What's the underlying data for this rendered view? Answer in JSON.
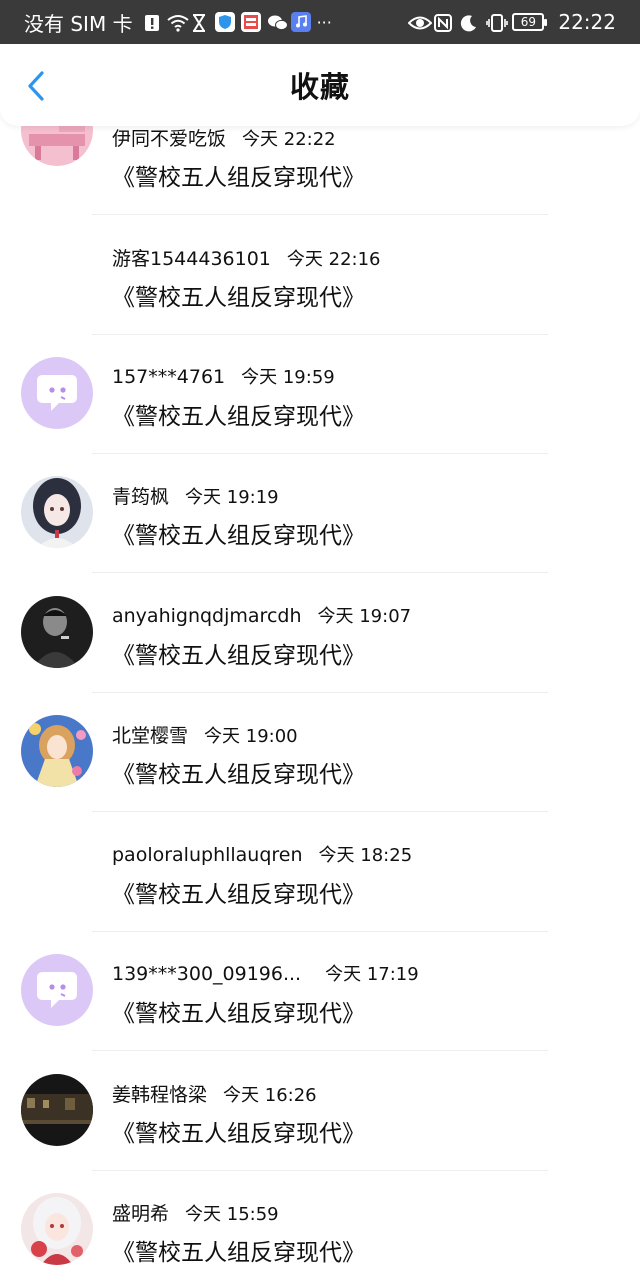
{
  "status_bar": {
    "carrier": "没有 SIM 卡",
    "battery": "69",
    "time": "22:22",
    "more": "···"
  },
  "header": {
    "title": "收藏",
    "back_icon": "chevron-left-icon"
  },
  "colors": {
    "accent": "#2f95ec",
    "status_bar_bg": "#3a3a3a",
    "divider": "#eeeeee",
    "chat_avatar_bg": "#dcc8f6",
    "chat_avatar_icon": "#b58ee8"
  },
  "items": [
    {
      "user": "伊同不爱吃饭",
      "time": "今天 22:22",
      "book": "《警校五人组反穿现代》",
      "avatar": "pink-room-illustration"
    },
    {
      "user": "游客1544436101",
      "time": "今天 22:16",
      "book": "《警校五人组反穿现代》",
      "avatar": "none"
    },
    {
      "user": "157***4761",
      "time": "今天 19:59",
      "book": "《警校五人组反穿现代》",
      "avatar": "default-chat-icon"
    },
    {
      "user": "青筠枫",
      "time": "今天 19:19",
      "book": "《警校五人组反穿现代》",
      "avatar": "anime-girl-portrait"
    },
    {
      "user": "anyahignqdjmarcdh",
      "time": "今天 19:07",
      "book": "《警校五人组反穿现代》",
      "avatar": "black-white-man-photo"
    },
    {
      "user": "北堂樱雪",
      "time": "今天 19:00",
      "book": "《警校五人组反穿现代》",
      "avatar": "anime-girl-gold-dress"
    },
    {
      "user": "paoloraluphllauqren",
      "time": "今天 18:25",
      "book": "《警校五人组反穿现代》",
      "avatar": "none"
    },
    {
      "user": "139***300_09196...",
      "time": "今天 17:19",
      "book": "《警校五人组反穿现代》",
      "avatar": "default-chat-icon"
    },
    {
      "user": "姜韩程恪梁",
      "time": "今天 16:26",
      "book": "《警校五人组反穿现代》",
      "avatar": "dark-street-scene"
    },
    {
      "user": "盛明希",
      "time": "今天 15:59",
      "book": "《警校五人组反穿现代》",
      "avatar": "anime-white-hair-girl"
    }
  ]
}
